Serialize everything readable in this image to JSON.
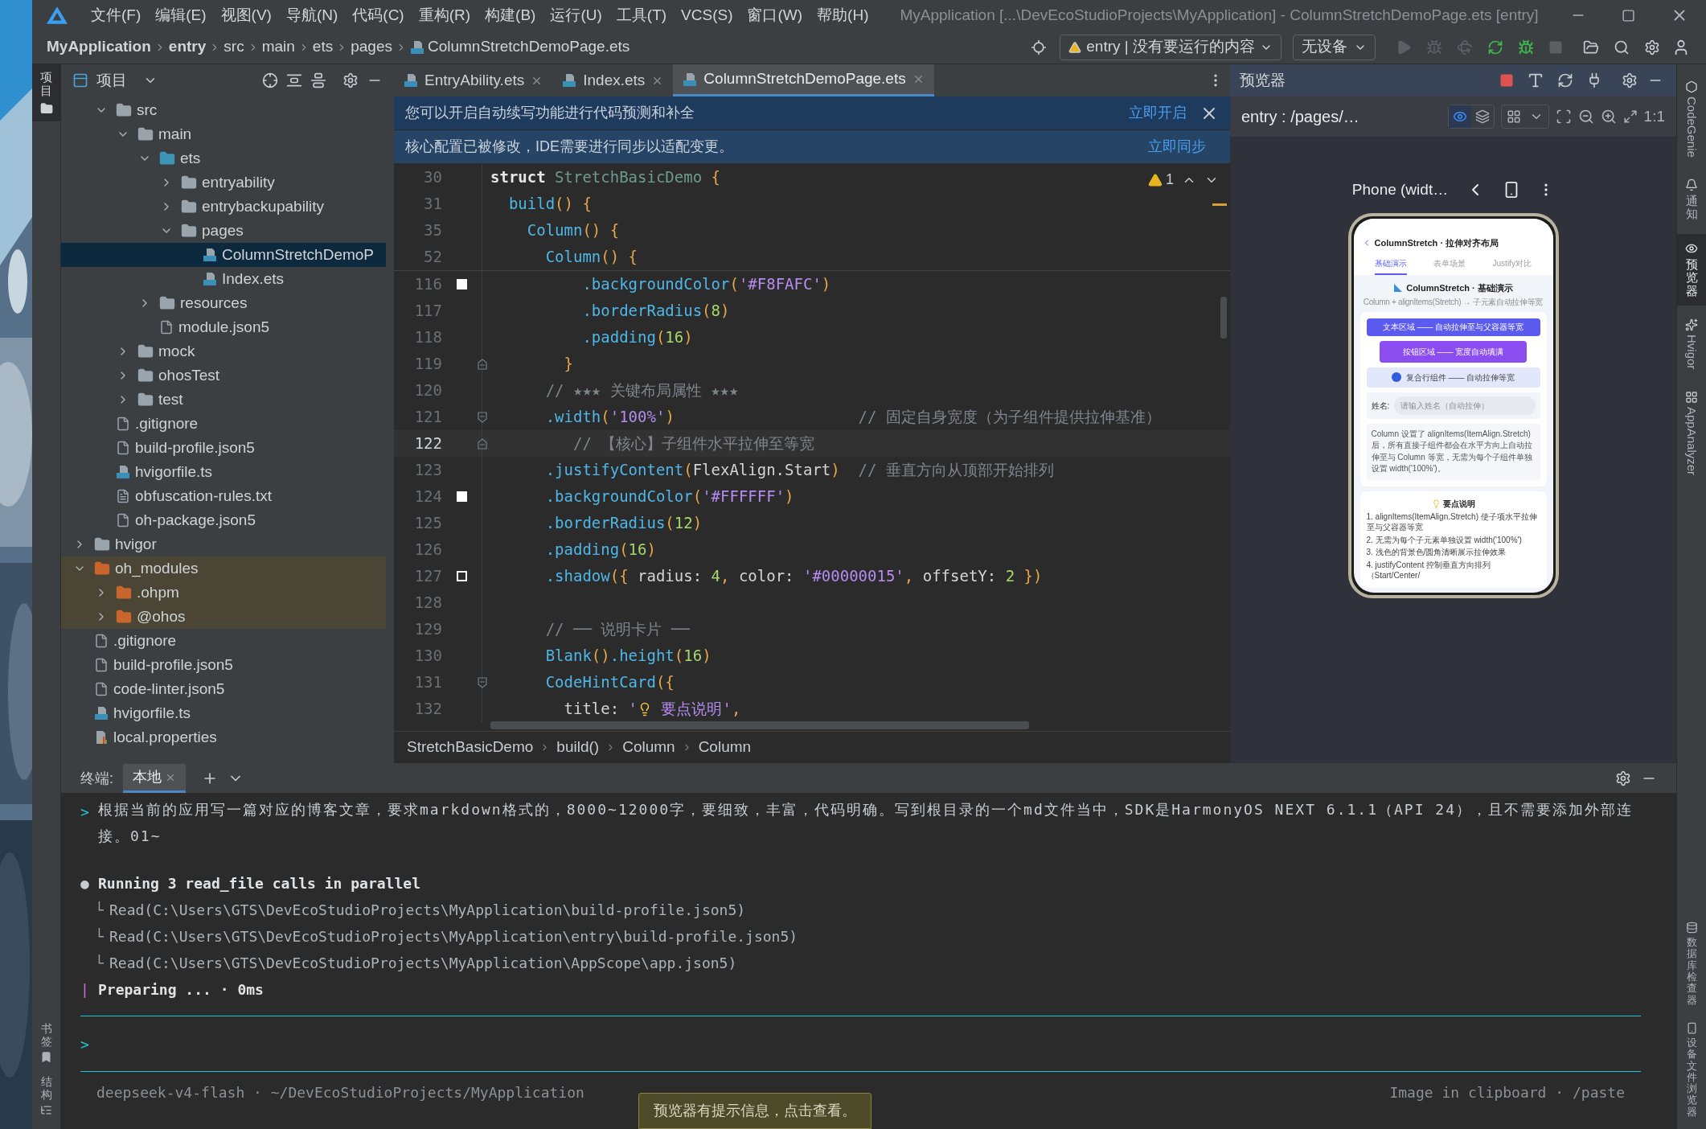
{
  "window": {
    "title": "MyApplication [...\\DevEcoStudioProjects\\MyApplication] - ColumnStretchDemoPage.ets [entry]"
  },
  "menu": [
    "文件(F)",
    "编辑(E)",
    "视图(V)",
    "导航(N)",
    "代码(C)",
    "重构(R)",
    "构建(B)",
    "运行(U)",
    "工具(T)",
    "VCS(S)",
    "窗口(W)",
    "帮助(H)"
  ],
  "breadcrumb": [
    {
      "label": "MyApplication",
      "bold": true
    },
    {
      "label": "entry",
      "bold": true
    },
    {
      "label": "src",
      "bold": false
    },
    {
      "label": "main",
      "bold": false
    },
    {
      "label": "ets",
      "bold": false
    },
    {
      "label": "pages",
      "bold": false
    },
    {
      "label": "ColumnStretchDemoPage.ets",
      "bold": false,
      "kind": "ets"
    }
  ],
  "run_config": "entry | 没有要运行的内容",
  "device_select": "无设备",
  "left_strip": {
    "top": "项目",
    "bottom": [
      "书签",
      "结构"
    ]
  },
  "project": {
    "title": "项目",
    "tree": [
      {
        "children": [
          {
            "label": "src",
            "kind": "folder",
            "expanded": true,
            "selected": false,
            "highlighted": false,
            "children": [
              {
                "label": "main",
                "kind": "folder",
                "expanded": true,
                "selected": false,
                "highlighted": false,
                "children": [
                  {
                    "label": "ets",
                    "kind": "source",
                    "expanded": true,
                    "selected": false,
                    "highlighted": false,
                    "children": [
                      {
                        "label": "entryability",
                        "kind": "folder",
                        "expanded": false,
                        "selected": false,
                        "highlighted": false
                      },
                      {
                        "label": "entrybackupability",
                        "kind": "folder",
                        "expanded": false,
                        "selected": false,
                        "highlighted": false
                      },
                      {
                        "label": "pages",
                        "kind": "folder",
                        "expanded": true,
                        "selected": false,
                        "highlighted": false,
                        "children": [
                          {
                            "label": "ColumnStretchDemoP",
                            "kind": "ets",
                            "selected": true,
                            "highlighted": false
                          },
                          {
                            "label": "Index.ets",
                            "kind": "ets",
                            "selected": false,
                            "highlighted": false
                          }
                        ]
                      }
                    ]
                  },
                  {
                    "label": "resources",
                    "kind": "folder",
                    "expanded": false,
                    "selected": false,
                    "highlighted": false
                  },
                  {
                    "label": "module.json5",
                    "kind": "json",
                    "selected": false,
                    "highlighted": false
                  }
                ]
              },
              {
                "label": "mock",
                "kind": "folder",
                "expanded": false,
                "selected": false,
                "highlighted": false
              },
              {
                "label": "ohosTest",
                "kind": "folder",
                "expanded": false,
                "selected": false,
                "highlighted": false
              },
              {
                "label": "test",
                "kind": "folder",
                "expanded": false,
                "selected": false,
                "highlighted": false
              }
            ]
          },
          {
            "label": ".gitignore",
            "kind": "ignore",
            "selected": false,
            "highlighted": false
          },
          {
            "label": "build-profile.json5",
            "kind": "json",
            "selected": false,
            "highlighted": false
          },
          {
            "label": "hvigorfile.ts",
            "kind": "ts",
            "selected": false,
            "highlighted": false
          },
          {
            "label": "obfuscation-rules.txt",
            "kind": "txt",
            "selected": false,
            "highlighted": false
          },
          {
            "label": "oh-package.json5",
            "kind": "json",
            "selected": false,
            "highlighted": false
          }
        ]
      },
      {
        "label": "hvigor",
        "kind": "folder",
        "expanded": false,
        "selected": false,
        "highlighted": false
      },
      {
        "label": "oh_modules",
        "kind": "module",
        "expanded": true,
        "selected": false,
        "highlighted": true,
        "children": [
          {
            "label": ".ohpm",
            "kind": "module",
            "expanded": false,
            "selected": false,
            "highlighted": true
          },
          {
            "label": "@ohos",
            "kind": "module",
            "expanded": false,
            "selected": false,
            "highlighted": true
          }
        ]
      },
      {
        "label": ".gitignore",
        "kind": "ignore",
        "selected": false,
        "highlighted": false
      },
      {
        "label": "build-profile.json5",
        "kind": "json",
        "selected": false,
        "highlighted": false
      },
      {
        "label": "code-linter.json5",
        "kind": "json",
        "selected": false,
        "highlighted": false
      },
      {
        "label": "hvigorfile.ts",
        "kind": "ts",
        "selected": false,
        "highlighted": false
      },
      {
        "label": "local.properties",
        "kind": "properties",
        "selected": false,
        "highlighted": false
      }
    ]
  },
  "editor_tabs": [
    {
      "label": "EntryAbility.ets",
      "selected": false
    },
    {
      "label": "Index.ets",
      "selected": false
    },
    {
      "label": "ColumnStretchDemoPage.ets",
      "selected": true
    }
  ],
  "banners": [
    {
      "text": "您可以开启自动续写功能进行代码预测和补全",
      "action": "立即开启",
      "closable": true
    },
    {
      "text": "核心配置已被修改，IDE需要进行同步以适配变更。",
      "action": "立即同步",
      "closable": false
    }
  ],
  "warnings": "1",
  "sticky_lines": [
    {
      "number": "30",
      "tokens": [
        {
          "kind": "kw",
          "text": "struct "
        },
        {
          "kind": "cls",
          "text": "StretchBasicDemo "
        },
        {
          "kind": "br",
          "text": "{"
        }
      ]
    },
    {
      "number": "31",
      "tokens": [
        {
          "kind": "fn",
          "text": "  build"
        },
        {
          "kind": "br",
          "text": "() {"
        }
      ]
    },
    {
      "number": "35",
      "tokens": [
        {
          "kind": "fn",
          "text": "    Column"
        },
        {
          "kind": "br",
          "text": "() {"
        }
      ]
    },
    {
      "number": "52",
      "tokens": [
        {
          "kind": "fn",
          "text": "      Column"
        },
        {
          "kind": "br",
          "text": "() {"
        }
      ]
    }
  ],
  "code_lines": [
    {
      "number": "116",
      "kind": "plain",
      "current": false,
      "swatch": {
        "color": "#f8fafc",
        "hollow": false
      },
      "tokens": [
        {
          "kind": "fn",
          "text": "          .backgroundColor"
        },
        {
          "kind": "br",
          "text": "("
        },
        {
          "kind": "str",
          "text": "'#F8FAFC'"
        },
        {
          "kind": "br",
          "text": ")"
        }
      ]
    },
    {
      "number": "117",
      "kind": "plain",
      "current": false,
      "tokens": [
        {
          "kind": "fn",
          "text": "          .borderRadius"
        },
        {
          "kind": "br",
          "text": "("
        },
        {
          "kind": "num",
          "text": "8"
        },
        {
          "kind": "br",
          "text": ")"
        }
      ]
    },
    {
      "number": "118",
      "kind": "plain",
      "current": false,
      "tokens": [
        {
          "kind": "fn",
          "text": "          .padding"
        },
        {
          "kind": "br",
          "text": "("
        },
        {
          "kind": "num",
          "text": "16"
        },
        {
          "kind": "br",
          "text": ")"
        }
      ]
    },
    {
      "number": "119",
      "kind": "fold-end",
      "current": false,
      "tokens": [
        {
          "kind": "br",
          "text": "        }"
        }
      ]
    },
    {
      "number": "120",
      "kind": "plain",
      "current": false,
      "tokens": [
        {
          "kind": "cmt",
          "text": "      // ★★★ 关键布局属性 ★★★"
        }
      ]
    },
    {
      "number": "121",
      "kind": "fold-start",
      "current": false,
      "tokens": [
        {
          "kind": "fn",
          "text": "      .width"
        },
        {
          "kind": "br",
          "text": "("
        },
        {
          "kind": "str",
          "text": "'100%'"
        },
        {
          "kind": "br",
          "text": ")"
        },
        {
          "kind": "cmt",
          "text": "                    // 固定自身宽度（为子组件提供拉伸基准）"
        }
      ]
    },
    {
      "number": "122",
      "kind": "fold-end",
      "current": true,
      "tokens": [
        {
          "kind": "cmt",
          "text": "         // 【核心】子组件水平拉伸至等宽"
        }
      ]
    },
    {
      "number": "123",
      "kind": "plain",
      "current": false,
      "tokens": [
        {
          "kind": "fn",
          "text": "      .justifyContent"
        },
        {
          "kind": "br",
          "text": "("
        },
        {
          "kind": "txt",
          "text": "FlexAlign.Start"
        },
        {
          "kind": "br",
          "text": ")"
        },
        {
          "kind": "cmt",
          "text": "  // 垂直方向从顶部开始排列"
        }
      ]
    },
    {
      "number": "124",
      "kind": "plain",
      "current": false,
      "swatch": {
        "color": "#ffffff",
        "hollow": false
      },
      "tokens": [
        {
          "kind": "fn",
          "text": "      .backgroundColor"
        },
        {
          "kind": "br",
          "text": "("
        },
        {
          "kind": "str",
          "text": "'#FFFFFF'"
        },
        {
          "kind": "br",
          "text": ")"
        }
      ]
    },
    {
      "number": "125",
      "kind": "plain",
      "current": false,
      "tokens": [
        {
          "kind": "fn",
          "text": "      .borderRadius"
        },
        {
          "kind": "br",
          "text": "("
        },
        {
          "kind": "num",
          "text": "12"
        },
        {
          "kind": "br",
          "text": ")"
        }
      ]
    },
    {
      "number": "126",
      "kind": "plain",
      "current": false,
      "tokens": [
        {
          "kind": "fn",
          "text": "      .padding"
        },
        {
          "kind": "br",
          "text": "("
        },
        {
          "kind": "num",
          "text": "16"
        },
        {
          "kind": "br",
          "text": ")"
        }
      ]
    },
    {
      "number": "127",
      "kind": "plain",
      "current": false,
      "swatch": {
        "color": "#ffffff",
        "hollow": true
      },
      "tokens": [
        {
          "kind": "fn",
          "text": "      .shadow"
        },
        {
          "kind": "br",
          "text": "({ "
        },
        {
          "kind": "txt",
          "text": "radius: "
        },
        {
          "kind": "num",
          "text": "4"
        },
        {
          "kind": "br",
          "text": ", "
        },
        {
          "kind": "txt",
          "text": "color: "
        },
        {
          "kind": "str",
          "text": "'#00000015'"
        },
        {
          "kind": "br",
          "text": ", "
        },
        {
          "kind": "txt",
          "text": "offsetY: "
        },
        {
          "kind": "num",
          "text": "2"
        },
        {
          "kind": "br",
          "text": " })"
        }
      ]
    },
    {
      "number": "128",
      "kind": "plain",
      "current": false
    },
    {
      "number": "129",
      "kind": "plain",
      "current": false,
      "tokens": [
        {
          "kind": "cmt",
          "text": "      // ── 说明卡片 ──"
        }
      ]
    },
    {
      "number": "130",
      "kind": "plain",
      "current": false,
      "tokens": [
        {
          "kind": "fn",
          "text": "      Blank"
        },
        {
          "kind": "br",
          "text": "()"
        },
        {
          "kind": "fn",
          "text": ".height"
        },
        {
          "kind": "br",
          "text": "("
        },
        {
          "kind": "num",
          "text": "16"
        },
        {
          "kind": "br",
          "text": ")"
        }
      ]
    },
    {
      "number": "131",
      "kind": "fold-start",
      "current": false,
      "tokens": [
        {
          "kind": "fn",
          "text": "      CodeHintCard"
        },
        {
          "kind": "br",
          "text": "({"
        }
      ]
    },
    {
      "number": "132",
      "kind": "plain",
      "current": false,
      "tokens": [
        {
          "kind": "txt",
          "text": "        title: "
        },
        {
          "kind": "str",
          "text": "'"
        },
        {
          "kind": "bulb"
        },
        {
          "kind": "str",
          "text": " 要点说明'"
        },
        {
          "kind": "br",
          "text": ","
        }
      ]
    }
  ],
  "code_path": [
    "StretchBasicDemo",
    "build()",
    "Column",
    "Column"
  ],
  "preview": {
    "title": "预览器",
    "target": "entry : /pages/…",
    "inspector_on": true,
    "scale": "1:1",
    "device": "Phone (widt…",
    "app": {
      "title": "ColumnStretch · 拉伸对齐布局",
      "tabs": [
        {
          "label": "基础演示",
          "selected": true
        },
        {
          "label": "表单场景",
          "selected": false
        },
        {
          "label": "Justify对比",
          "selected": false
        }
      ],
      "heading": "ColumnStretch · 基础演示",
      "subtitle": "Column + alignItems(Stretch) → 子元素自动拉伸等宽",
      "blocks": [
        {
          "kind": "text",
          "label": "文本区域 —— 自动拉伸至与父容器等宽"
        },
        {
          "kind": "button",
          "label": "按钮区域 —— 宽度自动填满"
        },
        {
          "kind": "row",
          "label": "复合行组件 —— 自动拉伸等宽"
        }
      ],
      "field": {
        "label": "姓名:",
        "placeholder": "请输入姓名（自动拉伸）"
      },
      "note": "Column 设置了 alignItems(ItemAlign.Stretch) 后，所有直接子组件都会在水平方向上自动拉伸至与 Column 等宽，无需为每个子组件单独设置 width('100%')。",
      "card": {
        "title": "要点说明",
        "points": [
          "1. alignItems(ItemAlign.Stretch) 使子项水平拉伸至与父容器等宽",
          "2. 无需为每个子元素单独设置 width('100%')",
          "3. 浅色的背景色/圆角清晰展示拉伸效果",
          "4. justifyContent 控制垂直方向排列（Start/Center/"
        ]
      }
    }
  },
  "right_strip": [
    {
      "label": "CodeGenie",
      "selected": false
    },
    {
      "label": "通知",
      "selected": false
    },
    {
      "label": "预览器",
      "selected": true
    },
    {
      "label": "Hvigor",
      "selected": false
    },
    {
      "label": "AppAnalyzer",
      "selected": false
    }
  ],
  "right_strip_bottom": [
    "数据库检查器",
    "设备文件浏览器"
  ],
  "terminal": {
    "title": "终端:",
    "tabs": [
      {
        "label": "本地",
        "selected": true
      }
    ],
    "lines": [
      {
        "kind": "prompt",
        "marker": ">",
        "text": "根据当前的应用写一篇对应的博客文章，要求markdown格式的，8000~12000字，要细致，丰富，代码明确。写到根目录的一个md文件当中，SDK是HarmonyOS NEXT 6.1.1（API 24），且不需要添加外部连接。01~"
      },
      {
        "kind": "status",
        "marker": "●",
        "text": "Running 3 read_file calls in parallel"
      },
      {
        "kind": "tool",
        "marker": "└",
        "text": "Read(C:\\Users\\GTS\\DevEcoStudioProjects\\MyApplication\\build-profile.json5)"
      },
      {
        "kind": "tool",
        "marker": "└",
        "text": "Read(C:\\Users\\GTS\\DevEcoStudioProjects\\MyApplication\\entry\\build-profile.json5)"
      },
      {
        "kind": "tool",
        "marker": "└",
        "text": "Read(C:\\Users\\GTS\\DevEcoStudioProjects\\MyApplication\\AppScope\\app.json5)"
      },
      {
        "kind": "progress",
        "marker": "|",
        "text": "Preparing ... · 0ms"
      }
    ],
    "input_marker": ">",
    "footer_left": "deepseek-v4-flash · ~/DevEcoStudioProjects/MyApplication",
    "footer_right": "Image in clipboard · /paste",
    "toast": "预览器有提示信息，点击查看。"
  }
}
